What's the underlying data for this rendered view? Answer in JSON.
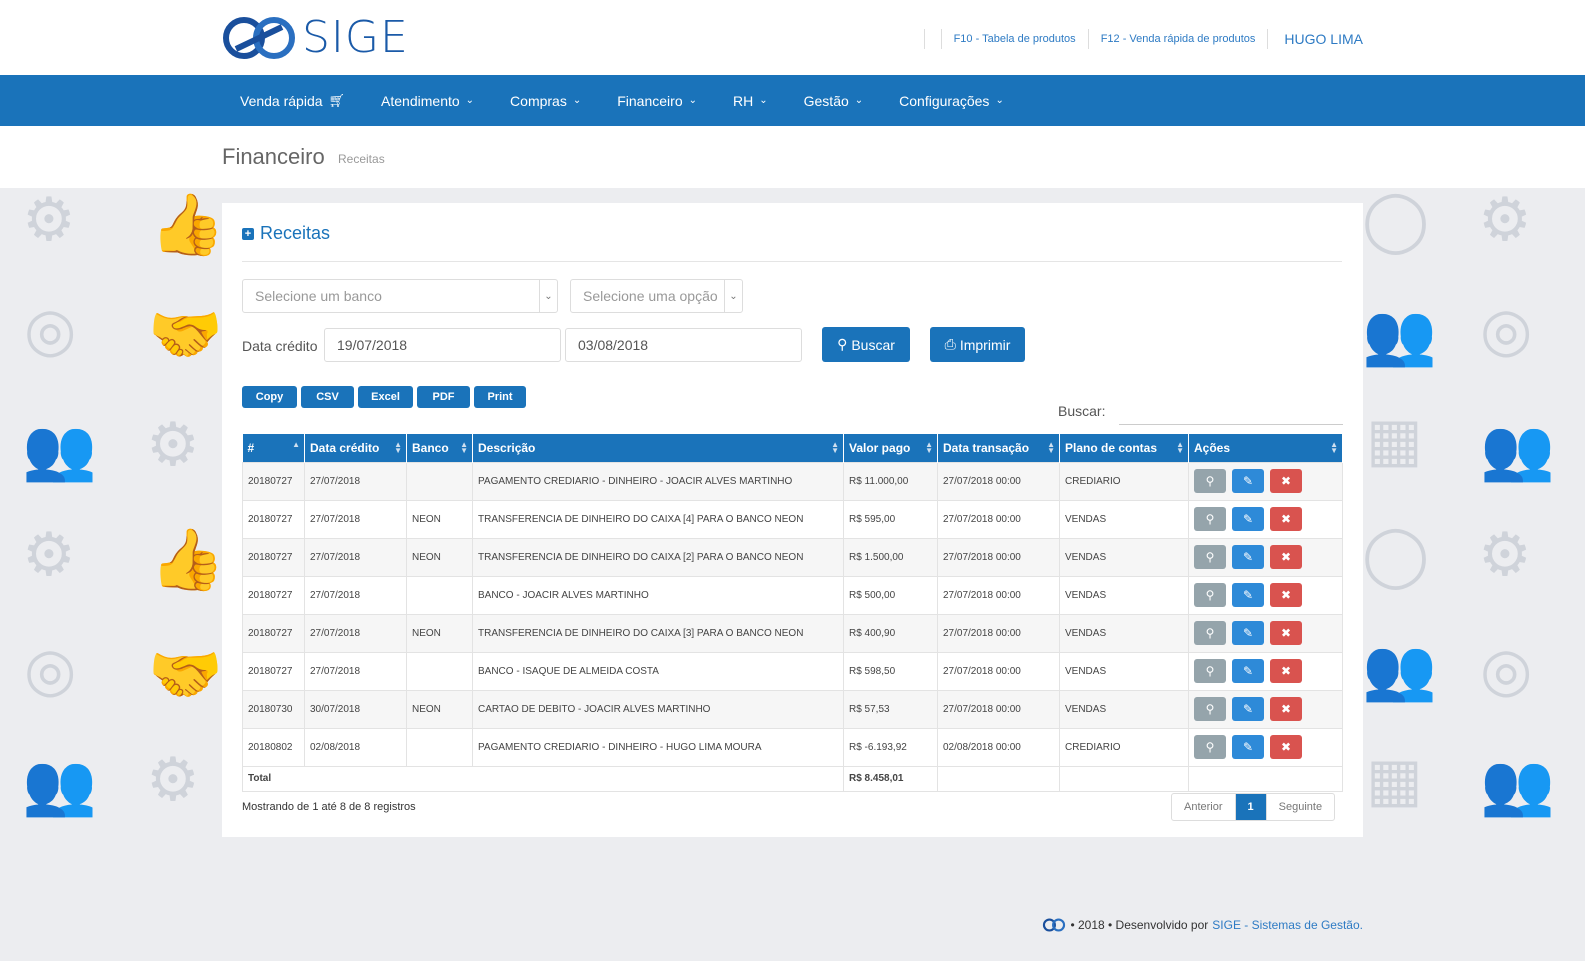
{
  "brand": {
    "name": "SIGE"
  },
  "top_links": {
    "f10": "F10 - Tabela de produtos",
    "f12": "F12 - Venda rápida de produtos",
    "user": "HUGO LIMA"
  },
  "nav": {
    "items": [
      {
        "label": "Venda rápida",
        "icon": "cart-icon"
      },
      {
        "label": "Atendimento",
        "icon": "chevron-down-icon"
      },
      {
        "label": "Compras",
        "icon": "chevron-down-icon"
      },
      {
        "label": "Financeiro",
        "icon": "chevron-down-icon"
      },
      {
        "label": "RH",
        "icon": "chevron-down-icon"
      },
      {
        "label": "Gestão",
        "icon": "chevron-down-icon"
      },
      {
        "label": "Configurações",
        "icon": "chevron-down-icon"
      }
    ]
  },
  "page": {
    "title": "Financeiro",
    "subtitle": "Receitas"
  },
  "panel": {
    "title": "Receitas",
    "bank_select": "Selecione um banco",
    "option_select": "Selecione uma opção",
    "date_label": "Data crédito",
    "date_from": "19/07/2018",
    "date_to": "03/08/2018",
    "search_button": "Buscar",
    "print_button": "Imprimir",
    "export_buttons": [
      "Copy",
      "CSV",
      "Excel",
      "PDF",
      "Print"
    ],
    "search_label": "Buscar:"
  },
  "table": {
    "columns": [
      "#",
      "Data crédito",
      "Banco",
      "Descrição",
      "Valor pago",
      "Data transação",
      "Plano de contas",
      "Ações"
    ],
    "rows": [
      [
        "20180727",
        "27/07/2018",
        "",
        "PAGAMENTO CREDIARIO - DINHEIRO - JOACIR ALVES MARTINHO",
        "R$ 11.000,00",
        "27/07/2018 00:00",
        "CREDIARIO"
      ],
      [
        "20180727",
        "27/07/2018",
        "NEON",
        "TRANSFERENCIA DE DINHEIRO DO CAIXA [4] PARA O BANCO NEON",
        "R$ 595,00",
        "27/07/2018 00:00",
        "VENDAS"
      ],
      [
        "20180727",
        "27/07/2018",
        "NEON",
        "TRANSFERENCIA DE DINHEIRO DO CAIXA [2] PARA O BANCO NEON",
        "R$ 1.500,00",
        "27/07/2018 00:00",
        "VENDAS"
      ],
      [
        "20180727",
        "27/07/2018",
        "",
        "BANCO - JOACIR ALVES MARTINHO",
        "R$ 500,00",
        "27/07/2018 00:00",
        "VENDAS"
      ],
      [
        "20180727",
        "27/07/2018",
        "NEON",
        "TRANSFERENCIA DE DINHEIRO DO CAIXA [3] PARA O BANCO NEON",
        "R$ 400,90",
        "27/07/2018 00:00",
        "VENDAS"
      ],
      [
        "20180727",
        "27/07/2018",
        "",
        "BANCO - ISAQUE DE ALMEIDA COSTA",
        "R$ 598,50",
        "27/07/2018 00:00",
        "VENDAS"
      ],
      [
        "20180730",
        "30/07/2018",
        "NEON",
        "CARTAO DE DEBITO - JOACIR ALVES MARTINHO",
        "R$ 57,53",
        "27/07/2018 00:00",
        "VENDAS"
      ],
      [
        "20180802",
        "02/08/2018",
        "",
        "PAGAMENTO CREDIARIO - DINHEIRO - HUGO LIMA MOURA",
        "R$ -6.193,92",
        "02/08/2018 00:00",
        "CREDIARIO"
      ]
    ],
    "total_label": "Total",
    "total_value": "R$ 8.458,01",
    "actions": [
      "search-icon",
      "pencil-icon",
      "close-icon"
    ]
  },
  "info": "Mostrando de 1 até 8 de 8 registros",
  "pager": {
    "prev": "Anterior",
    "current": "1",
    "next": "Seguinte"
  },
  "footer": {
    "text": "• 2018 • Desenvolvido por",
    "link": "SIGE - Sistemas de Gestão."
  },
  "colors": {
    "primary": "#1a73ba",
    "danger": "#d9534f",
    "muted": "#95a4ab"
  }
}
